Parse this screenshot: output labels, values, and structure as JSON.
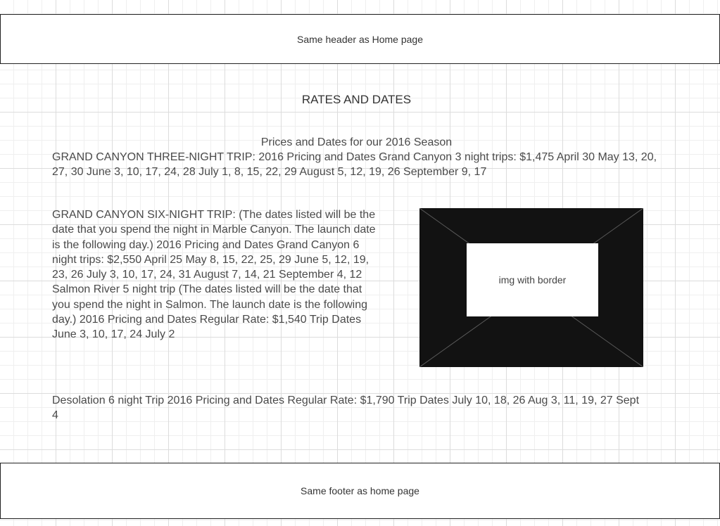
{
  "header": {
    "label": "Same header as Home page"
  },
  "page": {
    "title": "RATES AND DATES"
  },
  "content": {
    "season_heading": "Prices and Dates for our 2016 Season",
    "three_night": "GRAND CANYON THREE-NIGHT TRIP: 2016 Pricing and Dates Grand Canyon 3 night trips: $1,475 April 30 May 13, 20, 27, 30 June 3, 10, 17, 24, 28 July 1, 8, 15, 22, 29 August 5, 12, 19, 26 September 9, 17",
    "six_night": "GRAND CANYON SIX-NIGHT TRIP: (The dates listed will be the date that you spend the night in Marble Canyon. The launch date is the following day.) 2016 Pricing and Dates Grand Canyon 6 night trips: $2,550 April 25 May 8, 15, 22, 25, 29 June 5, 12, 19, 23, 26 July 3, 10, 17, 24, 31 August 7, 14, 21 September 4, 12 Salmon River 5 night trip (The dates listed will be the date that you spend the night in Salmon. The launch date is the following day.) 2016 Pricing and Dates Regular Rate: $1,540 Trip Dates June 3, 10, 17, 24 July 2",
    "desolation": "Desolation 6 night Trip 2016 Pricing and Dates Regular Rate: $1,790 Trip Dates July 10, 18, 26 Aug 3, 11, 19, 27 Sept 4"
  },
  "image": {
    "label": "img with border"
  },
  "footer": {
    "label": "Same footer as home page"
  }
}
